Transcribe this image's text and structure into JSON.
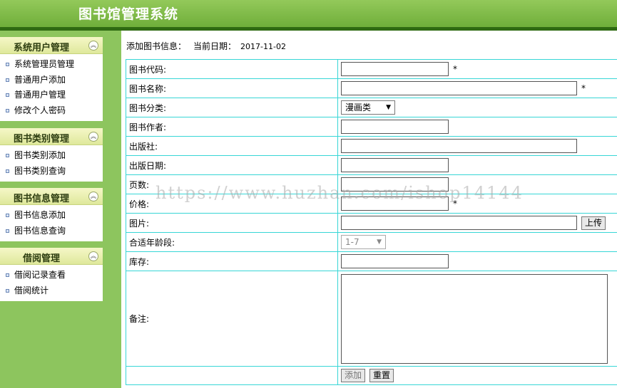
{
  "header": {
    "title": "图书馆管理系统"
  },
  "sidebar": {
    "groups": [
      {
        "title": "系统用户管理",
        "items": [
          "系统管理员管理",
          "普通用户添加",
          "普通用户管理",
          "修改个人密码"
        ]
      },
      {
        "title": "图书类别管理",
        "items": [
          "图书类别添加",
          "图书类别查询"
        ]
      },
      {
        "title": "图书信息管理",
        "items": [
          "图书信息添加",
          "图书信息查询"
        ]
      },
      {
        "title": "借阅管理",
        "items": [
          "借阅记录查看",
          "借阅统计"
        ]
      }
    ]
  },
  "main": {
    "info_label": "添加图书信息：",
    "date_label": "当前日期：",
    "date_value": "2017-11-02"
  },
  "form": {
    "required_mark": "*",
    "book_code": "图书代码:",
    "book_name": "图书名称:",
    "book_category": "图书分类:",
    "book_category_value": "漫画类",
    "author": "图书作者:",
    "publisher": "出版社:",
    "publish_date": "出版日期:",
    "pages": "页数:",
    "price": "价格:",
    "image": "图片:",
    "upload_button": "上传",
    "age_range": "合适年龄段:",
    "age_range_value": "1-7",
    "stock": "库存:",
    "remarks": "备注:",
    "add_button": "添加",
    "reset_button": "重置"
  },
  "watermark": "https://www.huzhan.com/ishop14144"
}
